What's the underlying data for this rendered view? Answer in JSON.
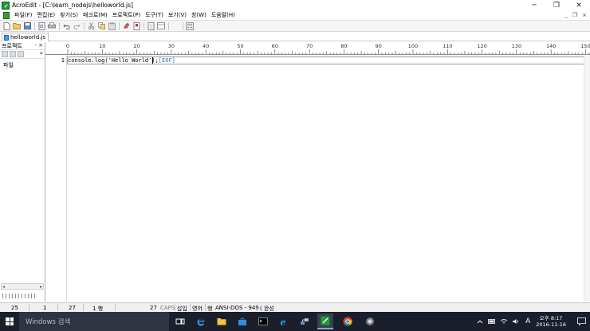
{
  "window": {
    "title": "AcroEdit - [C:\\learn_nodejs\\helloworld.js]",
    "minimize_label": "─",
    "restore_label": "❐",
    "close_label": "✕"
  },
  "menu": {
    "items": [
      "파일(F)",
      "편집(E)",
      "찾기(S)",
      "매크로(M)",
      "프로젝트(P)",
      "도구(T)",
      "보기(V)",
      "창(W)",
      "도움말(H)"
    ],
    "mdi_minimize": "_",
    "mdi_restore": "❐",
    "mdi_close": "×"
  },
  "tab": {
    "label": "helloworld.js"
  },
  "panel": {
    "title": "프로젝트",
    "controls": "- ×",
    "chevron": "»",
    "item": "파일",
    "scroll_left": "◂",
    "scroll_right": "▸"
  },
  "ruler": {
    "labels": [
      "0",
      "10",
      "20",
      "30",
      "40",
      "50",
      "60",
      "70",
      "80",
      "90",
      "100",
      "110",
      "120",
      "130",
      "140",
      "150"
    ]
  },
  "editor": {
    "line_number": "1",
    "code": "console.log('Hello World');",
    "eof": "[EOF]"
  },
  "status": {
    "line": "25",
    "col": "1",
    "pos": "27",
    "lines": "1 행",
    "chars": "27",
    "caps": "CAPS",
    "mode": "삽입",
    "lang": "영어",
    "sel": "행",
    "encoding": "ANSI-DOS - 949",
    "extra": "( 완성"
  },
  "taskbar": {
    "search_placeholder": "Windows 검색",
    "ime": "A",
    "time": "오후 8:17",
    "date": "2016-11-16"
  },
  "colors": {
    "accent": "#1e9c3a",
    "eof": "#2a7ab0",
    "taskbar": "#1a1f2b"
  }
}
